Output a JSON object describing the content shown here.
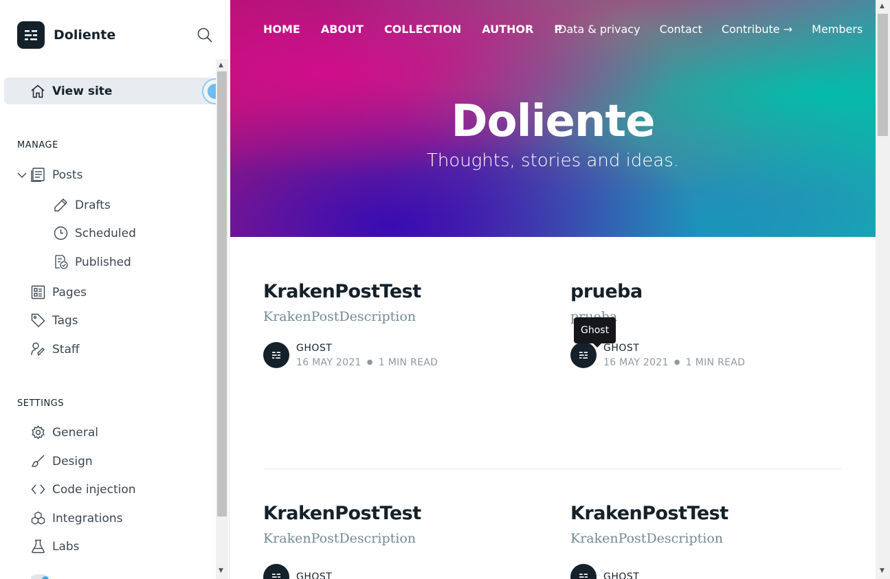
{
  "sidebar": {
    "site_name": "Doliente",
    "view_site": "View site",
    "manage_heading": "MANAGE",
    "settings_heading": "SETTINGS",
    "items": {
      "posts": "Posts",
      "drafts": "Drafts",
      "scheduled": "Scheduled",
      "published": "Published",
      "pages": "Pages",
      "tags": "Tags",
      "staff": "Staff",
      "general": "General",
      "design": "Design",
      "code_injection": "Code injection",
      "integrations": "Integrations",
      "labs": "Labs"
    }
  },
  "site": {
    "nav": [
      "HOME",
      "ABOUT",
      "COLLECTION",
      "AUTHOR",
      "PO"
    ],
    "secondary_nav": [
      "Data & privacy",
      "Contact",
      "Contribute →",
      "Members"
    ],
    "title": "Doliente",
    "description": "Thoughts, stories and ideas.",
    "tooltip": "Ghost",
    "posts": [
      {
        "title": "KrakenPostTest",
        "excerpt": "KrakenPostDescription",
        "author": "GHOST",
        "date": "16 MAY 2021",
        "reading_time": "1 MIN READ"
      },
      {
        "title": "prueba",
        "excerpt": "prueba",
        "author": "GHOST",
        "date": "16 MAY 2021",
        "reading_time": "1 MIN READ"
      },
      {
        "title": "KrakenPostTest",
        "excerpt": "KrakenPostDescription",
        "author": "GHOST",
        "date": "",
        "reading_time": ""
      },
      {
        "title": "KrakenPostTest",
        "excerpt": "KrakenPostDescription",
        "author": "GHOST",
        "date": "",
        "reading_time": ""
      }
    ]
  },
  "colors": {
    "sidebar_text": "#15212a",
    "active_bg": "#e8ecf1",
    "accent": "#6ebcf0",
    "muted": "#738a94"
  }
}
